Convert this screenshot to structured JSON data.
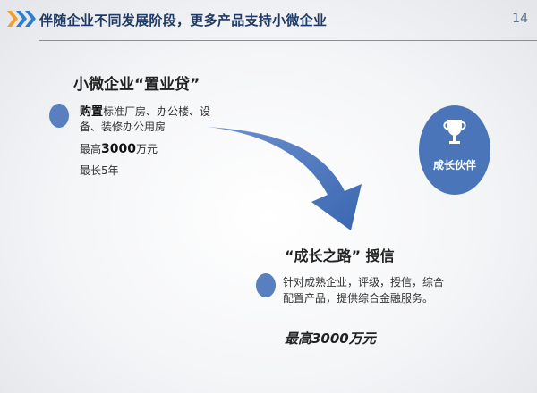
{
  "header": {
    "title": "伴随企业不同发展阶段，更多产品支持小微企业",
    "page_number": "14"
  },
  "section1": {
    "title": "小微企业“置业贷”",
    "purpose_label": "购置",
    "purpose_text": "标准厂房、办公楼、设备、装修办公用房",
    "max_prefix": "最高",
    "max_value": "3000",
    "max_suffix": "万元",
    "term": "最长5年"
  },
  "badge": {
    "label": "成长伙伴",
    "icon": "trophy-icon"
  },
  "section2": {
    "title": "“成长之路” 授信",
    "description": "针对成熟企业，评级，授信，综合配置产品，提供综合金融服务。",
    "max": "最高3000万元"
  },
  "colors": {
    "accent_blue": "#4a75b8",
    "dot_blue": "#5a7fbf",
    "header_text": "#1f3a66",
    "chevron_orange": "#f0a030",
    "chevron_blue": "#2f7fd0"
  }
}
